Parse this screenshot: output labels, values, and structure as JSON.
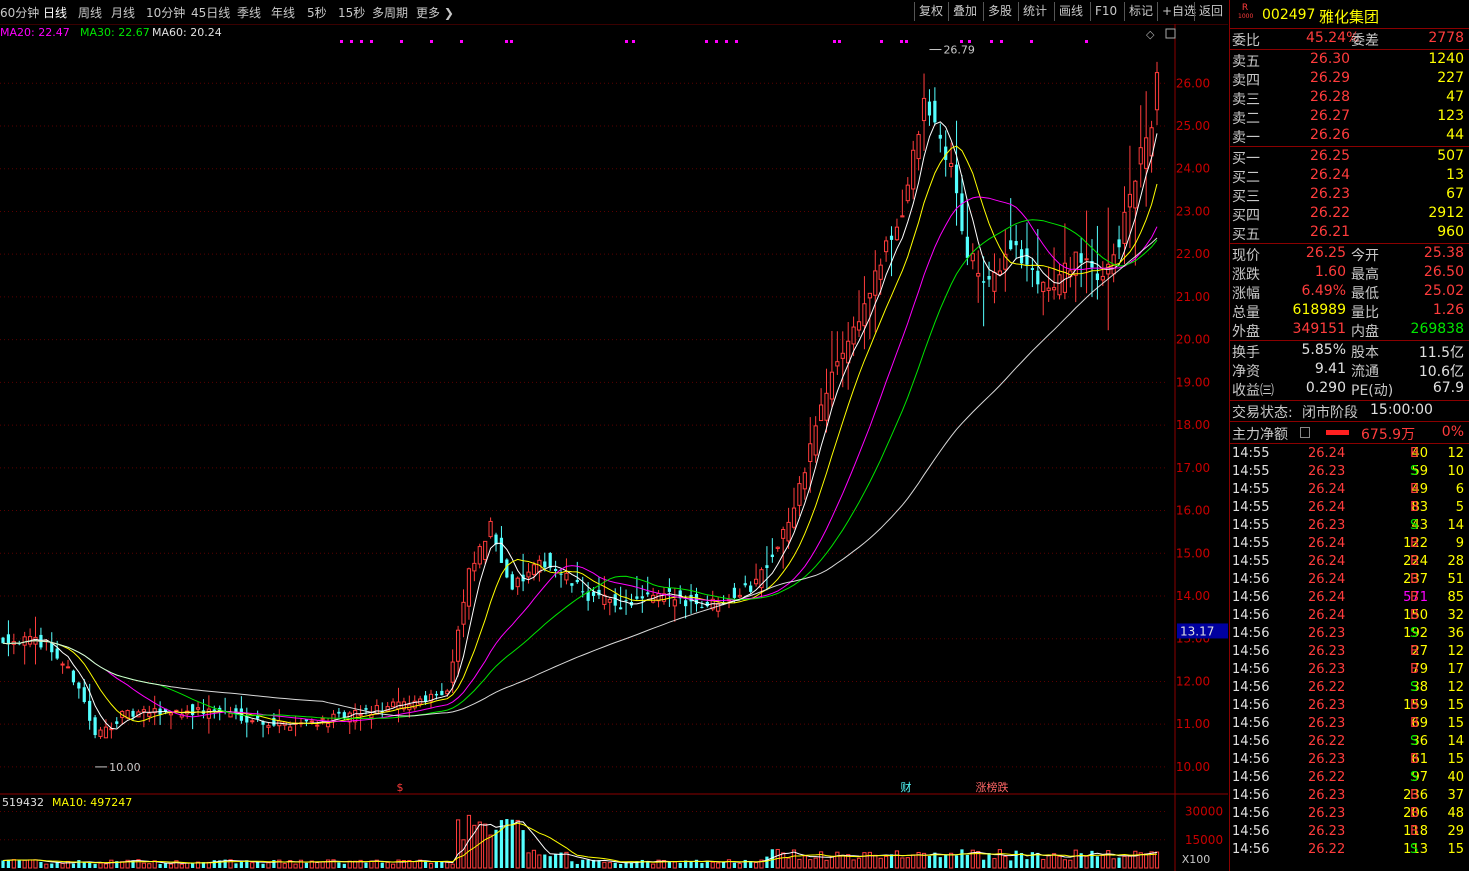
{
  "toolbar": {
    "periods": [
      "60分钟",
      "日线",
      "周线",
      "月线",
      "10分钟",
      "45日线",
      "季线",
      "年线",
      "5秒",
      "15秒",
      "多周期",
      "更多"
    ],
    "active_period": "日线",
    "buttons": [
      "复权",
      "叠加",
      "多股",
      "统计",
      "画线",
      "F10",
      "标记",
      "+自选",
      "返回"
    ]
  },
  "legend": {
    "ma20": "MA20: 22.47",
    "ma30": "MA30: 22.67",
    "ma60": "MA60: 20.24",
    "vol": "519432",
    "vol_ma10": "MA10: 497247"
  },
  "colors": {
    "up": "#ff3c3c",
    "down": "#54ffff",
    "ma5": "#ffffff",
    "ma10": "#ffff00",
    "ma20": "#ff00ff",
    "ma30": "#00e600",
    "ma60": "#ffffff"
  },
  "chart_data": {
    "type": "candlestick",
    "y_ticks": [
      "26.00",
      "25.00",
      "24.00",
      "23.00",
      "22.00",
      "21.00",
      "20.00",
      "19.00",
      "18.00",
      "17.00",
      "16.00",
      "15.00",
      "14.00",
      "13.00",
      "12.00",
      "11.00",
      "10.00"
    ],
    "ylim": [
      9.6,
      27.2
    ],
    "current_price_tag": "13.17",
    "high_marker": "26.79",
    "low_marker": "10.00",
    "vol_ticks": [
      "30000",
      "15000"
    ],
    "vol_unit": "X100",
    "annotations": [
      "$",
      "财",
      "涨榜跌"
    ],
    "anchors": [
      [
        0,
        13.0
      ],
      [
        8,
        12.9
      ],
      [
        14,
        11.9
      ],
      [
        17,
        10.7
      ],
      [
        22,
        11.2
      ],
      [
        30,
        11.3
      ],
      [
        40,
        11.3
      ],
      [
        50,
        11.0
      ],
      [
        60,
        11.1
      ],
      [
        68,
        11.3
      ],
      [
        75,
        11.5
      ],
      [
        82,
        11.8
      ],
      [
        86,
        14.5
      ],
      [
        90,
        15.6
      ],
      [
        94,
        14.2
      ],
      [
        100,
        14.8
      ],
      [
        108,
        14.0
      ],
      [
        114,
        13.8
      ],
      [
        122,
        14.0
      ],
      [
        130,
        13.8
      ],
      [
        138,
        14.2
      ],
      [
        142,
        15.0
      ],
      [
        146,
        16.0
      ],
      [
        150,
        18.0
      ],
      [
        154,
        19.5
      ],
      [
        158,
        20.5
      ],
      [
        162,
        21.8
      ],
      [
        166,
        23.0
      ],
      [
        170,
        25.5
      ],
      [
        172,
        25.0
      ],
      [
        175,
        24.0
      ],
      [
        178,
        22.0
      ],
      [
        182,
        21.2
      ],
      [
        186,
        22.3
      ],
      [
        190,
        21.5
      ],
      [
        194,
        21.2
      ],
      [
        198,
        22.0
      ],
      [
        202,
        21.4
      ],
      [
        206,
        22.3
      ],
      [
        210,
        24.3
      ],
      [
        212,
        25.0
      ],
      [
        213,
        26.25
      ]
    ]
  },
  "stock": {
    "code": "002497",
    "name": "雅化集团",
    "badge_top": "R",
    "badge_bot": "1000"
  },
  "order_book": {
    "weibi_label": "委比",
    "weibi": "45.24%",
    "weicha_label": "委差",
    "weicha": "2778",
    "asks": [
      {
        "label": "卖五",
        "price": "26.30",
        "vol": "1240"
      },
      {
        "label": "卖四",
        "price": "26.29",
        "vol": "227"
      },
      {
        "label": "卖三",
        "price": "26.28",
        "vol": "47"
      },
      {
        "label": "卖二",
        "price": "26.27",
        "vol": "123"
      },
      {
        "label": "卖一",
        "price": "26.26",
        "vol": "44"
      }
    ],
    "bids": [
      {
        "label": "买一",
        "price": "26.25",
        "vol": "507"
      },
      {
        "label": "买二",
        "price": "26.24",
        "vol": "13"
      },
      {
        "label": "买三",
        "price": "26.23",
        "vol": "67"
      },
      {
        "label": "买四",
        "price": "26.22",
        "vol": "2912"
      },
      {
        "label": "买五",
        "price": "26.21",
        "vol": "960"
      }
    ]
  },
  "quote": [
    {
      "l1": "现价",
      "v1": "26.25",
      "c1": "red",
      "l2": "今开",
      "v2": "25.38",
      "c2": "red"
    },
    {
      "l1": "涨跌",
      "v1": "1.60",
      "c1": "red",
      "l2": "最高",
      "v2": "26.50",
      "c2": "red"
    },
    {
      "l1": "涨幅",
      "v1": "6.49%",
      "c1": "red",
      "l2": "最低",
      "v2": "25.02",
      "c2": "red"
    },
    {
      "l1": "总量",
      "v1": "618989",
      "c1": "yel",
      "l2": "量比",
      "v2": "1.26",
      "c2": "red"
    },
    {
      "l1": "外盘",
      "v1": "349151",
      "c1": "red",
      "l2": "内盘",
      "v2": "269838",
      "c2": "green"
    }
  ],
  "fundamentals": [
    {
      "l1": "换手",
      "v1": "5.85%",
      "l2": "股本",
      "v2": "11.5亿"
    },
    {
      "l1": "净资",
      "v1": "9.41",
      "l2": "流通",
      "v2": "10.6亿"
    },
    {
      "l1": "收益㈢",
      "v1": "0.290",
      "l2": "PE(动)",
      "v2": "67.9"
    }
  ],
  "status": {
    "label": "交易状态:",
    "value": "闭市阶段",
    "time": "15:00:00"
  },
  "mainforce": {
    "label": "主力净额",
    "value": "675.9万",
    "pct": "0%"
  },
  "ticks": [
    {
      "t": "14:55",
      "p": "26.24",
      "v": "40",
      "s": "B",
      "n": "12",
      "c": "yel"
    },
    {
      "t": "14:55",
      "p": "26.23",
      "v": "59",
      "s": "S",
      "n": "10",
      "c": "yel"
    },
    {
      "t": "14:55",
      "p": "26.24",
      "v": "49",
      "s": "B",
      "n": "6",
      "c": "yel"
    },
    {
      "t": "14:55",
      "p": "26.24",
      "v": "83",
      "s": "B",
      "n": "5",
      "c": "yel"
    },
    {
      "t": "14:55",
      "p": "26.23",
      "v": "43",
      "s": "S",
      "n": "14",
      "c": "yel"
    },
    {
      "t": "14:55",
      "p": "26.24",
      "v": "122",
      "s": "B",
      "n": "9",
      "c": "yel"
    },
    {
      "t": "14:55",
      "p": "26.24",
      "v": "224",
      "s": "B",
      "n": "28",
      "c": "yel"
    },
    {
      "t": "14:56",
      "p": "26.24",
      "v": "237",
      "s": "B",
      "n": "51",
      "c": "yel"
    },
    {
      "t": "14:56",
      "p": "26.24",
      "v": "571",
      "s": "B",
      "n": "85",
      "c": "mag"
    },
    {
      "t": "14:56",
      "p": "26.24",
      "v": "150",
      "s": "B",
      "n": "32",
      "c": "yel"
    },
    {
      "t": "14:56",
      "p": "26.23",
      "v": "192",
      "s": "S",
      "n": "36",
      "c": "yel"
    },
    {
      "t": "14:56",
      "p": "26.23",
      "v": "27",
      "s": "B",
      "n": "12",
      "c": "yel"
    },
    {
      "t": "14:56",
      "p": "26.23",
      "v": "79",
      "s": "B",
      "n": "17",
      "c": "yel"
    },
    {
      "t": "14:56",
      "p": "26.22",
      "v": "38",
      "s": "S",
      "n": "12",
      "c": "yel"
    },
    {
      "t": "14:56",
      "p": "26.23",
      "v": "159",
      "s": "B",
      "n": "15",
      "c": "yel"
    },
    {
      "t": "14:56",
      "p": "26.23",
      "v": "69",
      "s": "B",
      "n": "15",
      "c": "yel"
    },
    {
      "t": "14:56",
      "p": "26.22",
      "v": "36",
      "s": "S",
      "n": "14",
      "c": "yel"
    },
    {
      "t": "14:56",
      "p": "26.23",
      "v": "61",
      "s": "B",
      "n": "15",
      "c": "yel"
    },
    {
      "t": "14:56",
      "p": "26.22",
      "v": "97",
      "s": "S",
      "n": "40",
      "c": "yel"
    },
    {
      "t": "14:56",
      "p": "26.23",
      "v": "236",
      "s": "B",
      "n": "37",
      "c": "yel"
    },
    {
      "t": "14:56",
      "p": "26.23",
      "v": "206",
      "s": "B",
      "n": "48",
      "c": "yel"
    },
    {
      "t": "14:56",
      "p": "26.23",
      "v": "118",
      "s": "B",
      "n": "29",
      "c": "yel"
    },
    {
      "t": "14:56",
      "p": "26.22",
      "v": "113",
      "s": "S",
      "n": "15",
      "c": "yel"
    }
  ]
}
